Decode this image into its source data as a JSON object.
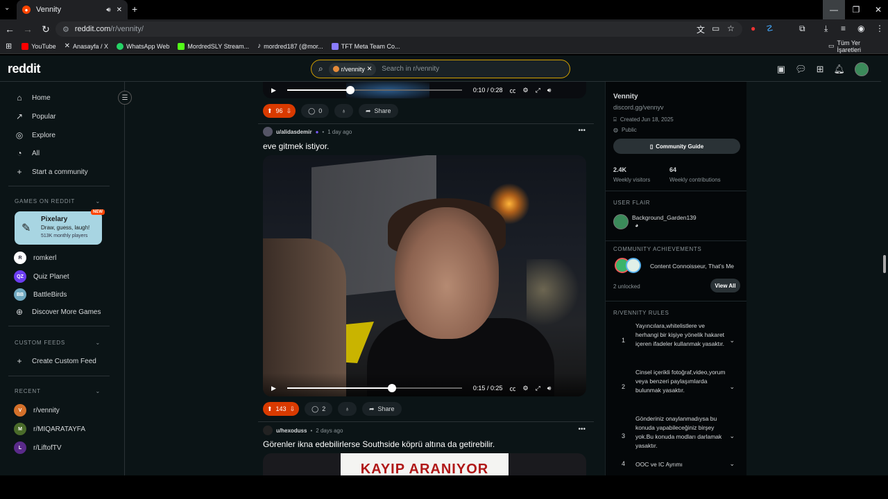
{
  "browser": {
    "tab_title": "Vennity",
    "url_host": "reddit.com",
    "url_path": "/r/vennity/",
    "bookmarks": [
      {
        "label": "YouTube",
        "color": "#ff0000"
      },
      {
        "label": "Anasayfa / X",
        "color": "#ffffff"
      },
      {
        "label": "WhatsApp Web",
        "color": "#25d366"
      },
      {
        "label": "MordredSLY Stream...",
        "color": "#53fc18"
      },
      {
        "label": "mordred187 (@mor...",
        "color": "#ffffff"
      },
      {
        "label": "TFT Meta Team Co...",
        "color": "#8a7cff"
      }
    ],
    "all_bookmarks": "Tüm Yer İşaretleri"
  },
  "header": {
    "logo": "reddit",
    "search_chip": "r/vennity",
    "search_placeholder": "Search in r/vennity"
  },
  "sidebar": {
    "nav": [
      {
        "label": "Home",
        "icon": "home-icon"
      },
      {
        "label": "Popular",
        "icon": "popular-icon"
      },
      {
        "label": "Explore",
        "icon": "explore-icon"
      },
      {
        "label": "All",
        "icon": "all-icon"
      },
      {
        "label": "Start a community",
        "icon": "plus-icon"
      }
    ],
    "games_heading": "GAMES ON REDDIT",
    "featured_game": {
      "title": "Pixelary",
      "subtitle": "Draw, guess, laugh!",
      "players": "513K monthly players",
      "badge": "NEW"
    },
    "games": [
      "romkerl",
      "Quiz Planet",
      "BattleBirds",
      "Discover More Games"
    ],
    "custom_heading": "CUSTOM FEEDS",
    "create_feed": "Create Custom Feed",
    "recent_heading": "RECENT",
    "recent": [
      "r/vennity",
      "r/MIQARATAYFA",
      "r/LiftofTV"
    ]
  },
  "feed": {
    "post1": {
      "time": "0:10 / 0:28",
      "progress": 0.36,
      "votes": "96",
      "comments": "0",
      "share": "Share"
    },
    "post2": {
      "author": "u/alidasdemir",
      "age": "1 day ago",
      "title": "eve gitmek istiyor.",
      "time": "0:15 / 0:25",
      "progress": 0.6,
      "votes": "143",
      "comments": "2",
      "share": "Share"
    },
    "post3": {
      "author": "u/hexoduss",
      "age": "2 days ago",
      "title": "Görenler ikna edebilirlerse Southside köprü altına da getirebilir.",
      "image_text": "KAYIP ARANIYOR"
    }
  },
  "community": {
    "name": "Vennity",
    "link": "discord.gg/vennyv",
    "created": "Created Jun 18, 2025",
    "visibility": "Public",
    "guide": "Community Guide",
    "visitors_value": "2.4K",
    "visitors_label": "Weekly visitors",
    "contrib_value": "64",
    "contrib_label": "Weekly contributions",
    "flair_heading": "USER FLAIR",
    "flair_user": "Background_Garden139",
    "ach_heading": "COMMUNITY ACHIEVEMENTS",
    "ach_names": "Content Connoisseur, That's Me",
    "ach_unlocked": "2 unlocked",
    "view_all": "View All",
    "rules_heading": "R/VENNITY RULES",
    "rules": [
      {
        "n": "1",
        "text": "Yayıncılara,whitelistlere ve herhangi bir kişiye yönelik hakaret içeren ifadeler kullanmak yasaktır."
      },
      {
        "n": "2",
        "text": "Cinsel içerikli fotoğraf,video,yorum veya benzeri paylaşımlarda bulunmak yasaktır."
      },
      {
        "n": "3",
        "text": "Gönderiniz onaylanmadıysa bu konuda yapabileceğiniz birşey yok.Bu konuda modları darlamak yasaktır."
      },
      {
        "n": "4",
        "text": "OOC ve IC Ayrımı"
      }
    ]
  }
}
